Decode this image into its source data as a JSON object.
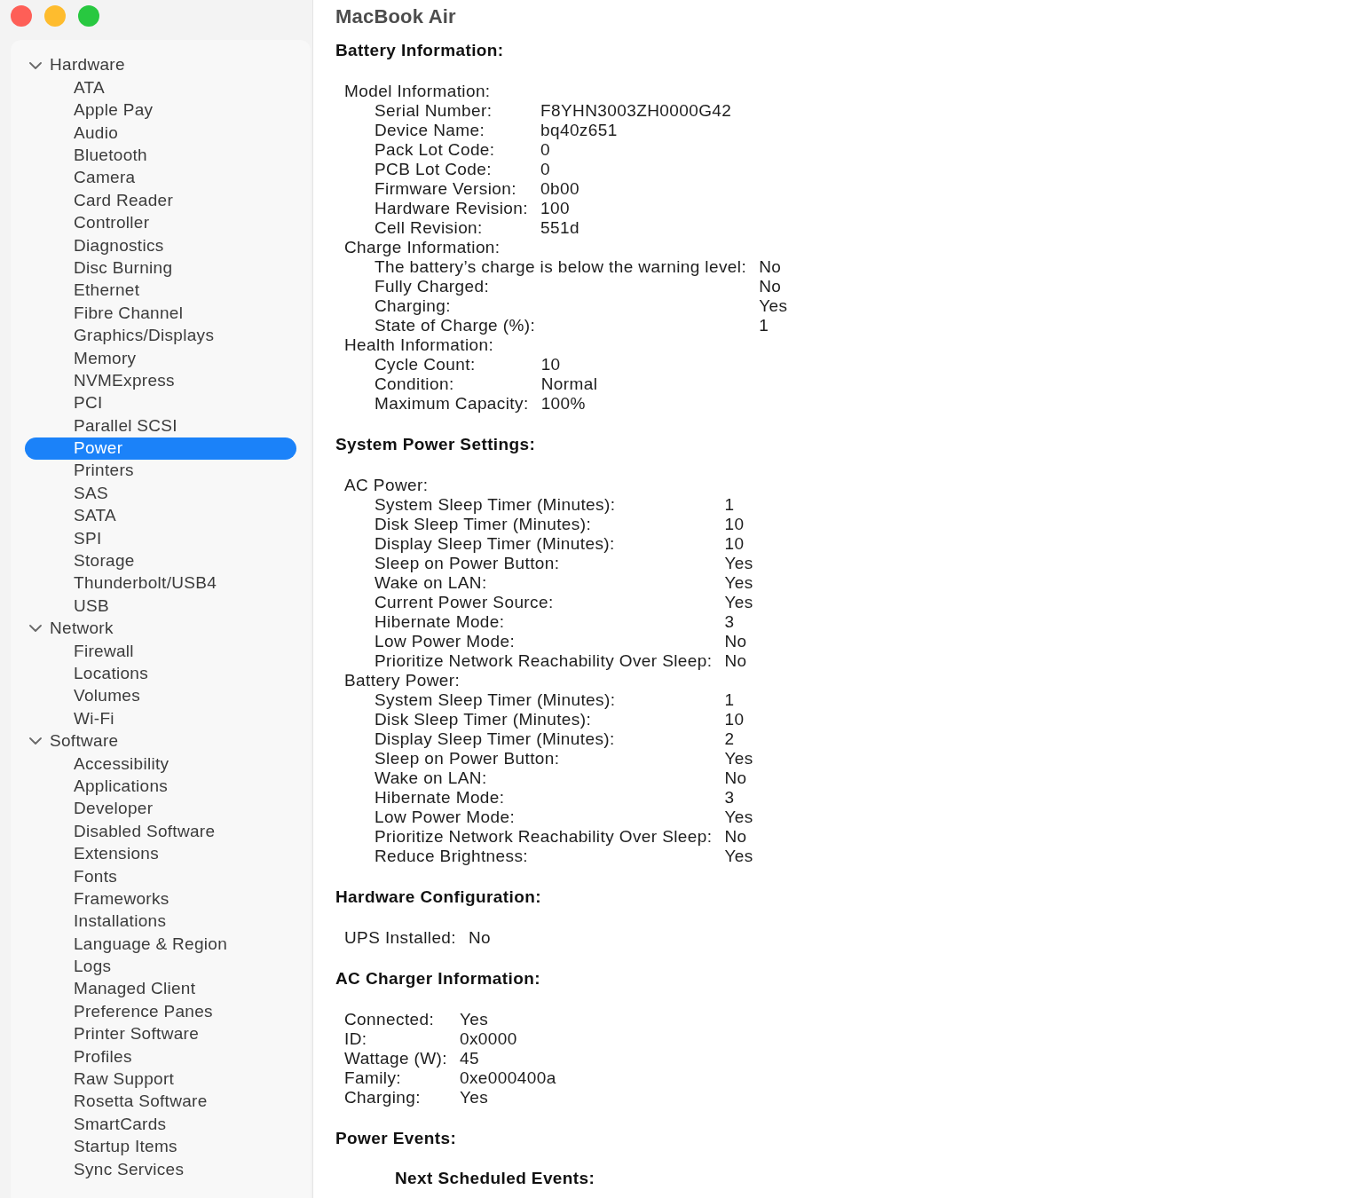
{
  "window": {
    "title": "MacBook Air"
  },
  "sidebar": {
    "items": [
      {
        "label": "Hardware",
        "expanded": true,
        "selected": false,
        "children": [
          {
            "label": "ATA",
            "selected": false
          },
          {
            "label": "Apple Pay",
            "selected": false
          },
          {
            "label": "Audio",
            "selected": false
          },
          {
            "label": "Bluetooth",
            "selected": false
          },
          {
            "label": "Camera",
            "selected": false
          },
          {
            "label": "Card Reader",
            "selected": false
          },
          {
            "label": "Controller",
            "selected": false
          },
          {
            "label": "Diagnostics",
            "selected": false
          },
          {
            "label": "Disc Burning",
            "selected": false
          },
          {
            "label": "Ethernet",
            "selected": false
          },
          {
            "label": "Fibre Channel",
            "selected": false
          },
          {
            "label": "Graphics/Displays",
            "selected": false
          },
          {
            "label": "Memory",
            "selected": false
          },
          {
            "label": "NVMExpress",
            "selected": false
          },
          {
            "label": "PCI",
            "selected": false
          },
          {
            "label": "Parallel SCSI",
            "selected": false
          },
          {
            "label": "Power",
            "selected": true
          },
          {
            "label": "Printers",
            "selected": false
          },
          {
            "label": "SAS",
            "selected": false
          },
          {
            "label": "SATA",
            "selected": false
          },
          {
            "label": "SPI",
            "selected": false
          },
          {
            "label": "Storage",
            "selected": false
          },
          {
            "label": "Thunderbolt/USB4",
            "selected": false
          },
          {
            "label": "USB",
            "selected": false
          }
        ]
      },
      {
        "label": "Network",
        "expanded": true,
        "selected": false,
        "children": [
          {
            "label": "Firewall",
            "selected": false
          },
          {
            "label": "Locations",
            "selected": false
          },
          {
            "label": "Volumes",
            "selected": false
          },
          {
            "label": "Wi-Fi",
            "selected": false
          }
        ]
      },
      {
        "label": "Software",
        "expanded": true,
        "selected": false,
        "children": [
          {
            "label": "Accessibility",
            "selected": false
          },
          {
            "label": "Applications",
            "selected": false
          },
          {
            "label": "Developer",
            "selected": false
          },
          {
            "label": "Disabled Software",
            "selected": false
          },
          {
            "label": "Extensions",
            "selected": false
          },
          {
            "label": "Fonts",
            "selected": false
          },
          {
            "label": "Frameworks",
            "selected": false
          },
          {
            "label": "Installations",
            "selected": false
          },
          {
            "label": "Language & Region",
            "selected": false
          },
          {
            "label": "Logs",
            "selected": false
          },
          {
            "label": "Managed Client",
            "selected": false
          },
          {
            "label": "Preference Panes",
            "selected": false
          },
          {
            "label": "Printer Software",
            "selected": false
          },
          {
            "label": "Profiles",
            "selected": false
          },
          {
            "label": "Raw Support",
            "selected": false
          },
          {
            "label": "Rosetta Software",
            "selected": false
          },
          {
            "label": "SmartCards",
            "selected": false
          },
          {
            "label": "Startup Items",
            "selected": false
          },
          {
            "label": "Sync Services",
            "selected": false
          }
        ]
      }
    ]
  },
  "content": {
    "sections": [
      {
        "heading": "Battery Information:",
        "groups": [
          {
            "label": "Model Information:",
            "rows": [
              {
                "label": "Serial Number:",
                "value": "F8YHN3003ZH0000G42"
              },
              {
                "label": "Device Name:",
                "value": "bq40z651"
              },
              {
                "label": "Pack Lot Code:",
                "value": "0"
              },
              {
                "label": "PCB Lot Code:",
                "value": "0"
              },
              {
                "label": "Firmware Version:",
                "value": "0b00"
              },
              {
                "label": "Hardware Revision:",
                "value": "100"
              },
              {
                "label": "Cell Revision:",
                "value": "551d"
              }
            ]
          },
          {
            "label": "Charge Information:",
            "rows": [
              {
                "label": "The battery’s charge is below the warning level:",
                "value": "No"
              },
              {
                "label": "Fully Charged:",
                "value": "No"
              },
              {
                "label": "Charging:",
                "value": "Yes"
              },
              {
                "label": "State of Charge (%):",
                "value": "1"
              }
            ]
          },
          {
            "label": "Health Information:",
            "rows": [
              {
                "label": "Cycle Count:",
                "value": "10"
              },
              {
                "label": "Condition:",
                "value": "Normal"
              },
              {
                "label": "Maximum Capacity:",
                "value": "100%"
              }
            ]
          }
        ]
      },
      {
        "heading": "System Power Settings:",
        "groups": [
          {
            "label": "AC Power:",
            "rows": [
              {
                "label": "System Sleep Timer (Minutes):",
                "value": "1"
              },
              {
                "label": "Disk Sleep Timer (Minutes):",
                "value": "10"
              },
              {
                "label": "Display Sleep Timer (Minutes):",
                "value": "10"
              },
              {
                "label": "Sleep on Power Button:",
                "value": "Yes"
              },
              {
                "label": "Wake on LAN:",
                "value": "Yes"
              },
              {
                "label": "Current Power Source:",
                "value": "Yes"
              },
              {
                "label": "Hibernate Mode:",
                "value": "3"
              },
              {
                "label": "Low Power Mode:",
                "value": "No"
              },
              {
                "label": "Prioritize Network Reachability Over Sleep:",
                "value": "No"
              }
            ]
          },
          {
            "label": "Battery Power:",
            "rows": [
              {
                "label": "System Sleep Timer (Minutes):",
                "value": "1"
              },
              {
                "label": "Disk Sleep Timer (Minutes):",
                "value": "10"
              },
              {
                "label": "Display Sleep Timer (Minutes):",
                "value": "2"
              },
              {
                "label": "Sleep on Power Button:",
                "value": "Yes"
              },
              {
                "label": "Wake on LAN:",
                "value": "No"
              },
              {
                "label": "Hibernate Mode:",
                "value": "3"
              },
              {
                "label": "Low Power Mode:",
                "value": "Yes"
              },
              {
                "label": "Prioritize Network Reachability Over Sleep:",
                "value": "No"
              },
              {
                "label": "Reduce Brightness:",
                "value": "Yes"
              }
            ]
          }
        ]
      },
      {
        "heading": "Hardware Configuration:",
        "groups": [
          {
            "rows": [
              {
                "label": "UPS Installed:",
                "value": "No"
              }
            ]
          }
        ]
      },
      {
        "heading": "AC Charger Information:",
        "groups": [
          {
            "rows": [
              {
                "label": "Connected:",
                "value": "Yes"
              },
              {
                "label": "ID:",
                "value": "0x0000"
              },
              {
                "label": "Wattage (W):",
                "value": "45"
              },
              {
                "label": "Family:",
                "value": "0xe000400a"
              },
              {
                "label": "Charging:",
                "value": "Yes"
              }
            ]
          }
        ]
      },
      {
        "heading": "Power Events:",
        "subsections": [
          {
            "heading": "Next Scheduled Events:"
          }
        ]
      }
    ]
  }
}
